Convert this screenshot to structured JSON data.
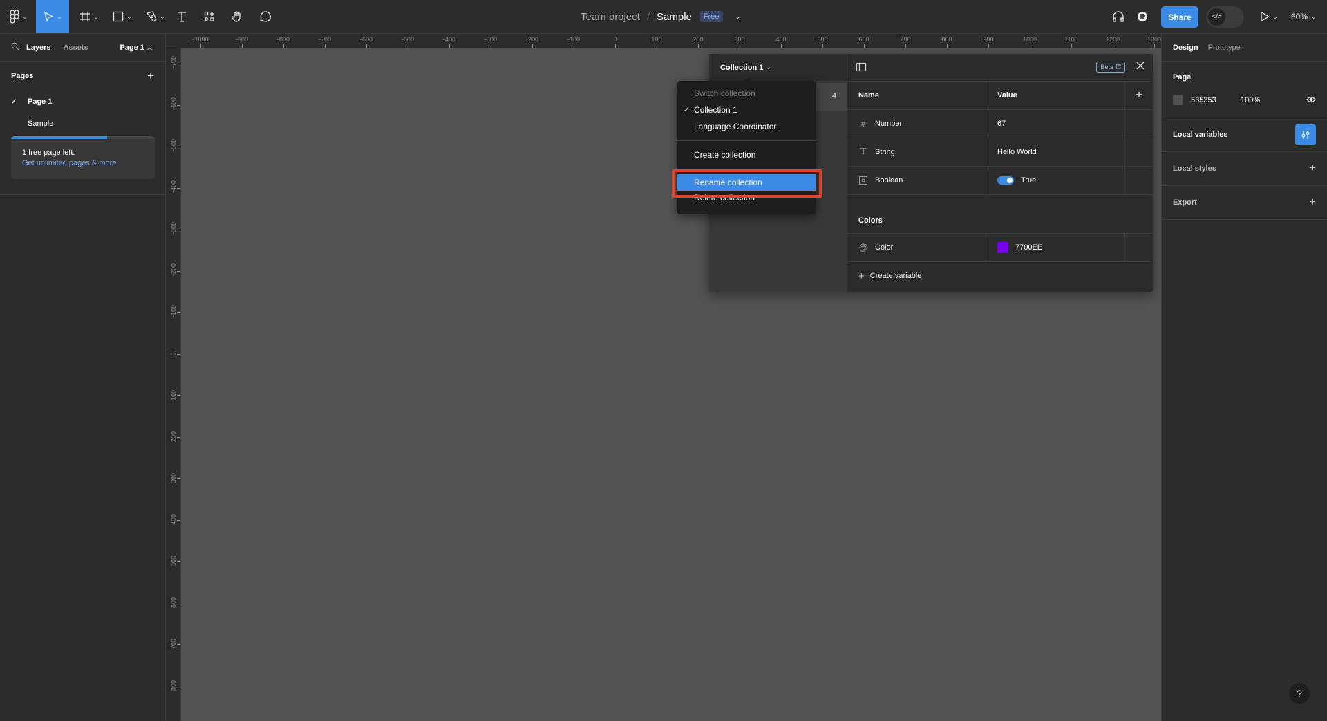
{
  "toolbar": {
    "tools": [
      {
        "name": "main-menu",
        "icon": "figma-logo-icon",
        "has_dropdown": true
      },
      {
        "name": "move-tool",
        "icon": "cursor-icon",
        "has_dropdown": true,
        "active": true
      },
      {
        "name": "frame-tool",
        "icon": "frame-icon",
        "has_dropdown": true
      },
      {
        "name": "shape-tool",
        "icon": "rectangle-icon",
        "has_dropdown": true
      },
      {
        "name": "pen-tool",
        "icon": "pen-icon",
        "has_dropdown": true
      },
      {
        "name": "text-tool",
        "icon": "text-icon",
        "has_dropdown": false
      },
      {
        "name": "resources-tool",
        "icon": "resources-icon",
        "has_dropdown": false
      },
      {
        "name": "hand-tool",
        "icon": "hand-icon",
        "has_dropdown": false
      },
      {
        "name": "comment-tool",
        "icon": "comment-icon",
        "has_dropdown": false
      }
    ],
    "breadcrumb": {
      "project": "Team project",
      "separator": "/",
      "file": "Sample",
      "plan_badge": "Free"
    },
    "share_label": "Share",
    "dev_mode_icon": "</>",
    "zoom_level": "60%",
    "accent_color": "#3b8ae6"
  },
  "left_panel": {
    "tabs": [
      {
        "label": "Layers",
        "active": true
      },
      {
        "label": "Assets",
        "active": false
      }
    ],
    "current_page": "Page 1",
    "pages_title": "Pages",
    "pages": [
      {
        "label": "Page 1",
        "active": true
      },
      {
        "label": "Sample",
        "active": false
      }
    ],
    "upsell": {
      "usage_fraction": 0.67,
      "text": "1 free page left.",
      "link": "Get unlimited pages & more"
    }
  },
  "rulers": {
    "horizontal": [
      "-1000",
      "-900",
      "-800",
      "-700",
      "-600",
      "-500",
      "-400",
      "-300",
      "-200",
      "-100",
      "0",
      "100",
      "200",
      "300",
      "400",
      "500",
      "600",
      "700",
      "800",
      "900",
      "1000",
      "1100",
      "1200",
      "1300"
    ],
    "vertical": [
      "-700",
      "-600",
      "-500",
      "-400",
      "-300",
      "-200",
      "-100",
      "0",
      "100",
      "200",
      "300",
      "400",
      "500",
      "600",
      "700",
      "800"
    ]
  },
  "canvas": {
    "background": "#535353"
  },
  "variables_panel": {
    "collection_name": "Collection 1",
    "variable_count": "4",
    "beta_label": "Beta",
    "columns": {
      "name": "Name",
      "value": "Value"
    },
    "variables": [
      {
        "type_icon": "number-icon",
        "glyph": "#",
        "name": "Number",
        "value": "67"
      },
      {
        "type_icon": "string-icon",
        "glyph": "T",
        "name": "String",
        "value": "Hello World"
      },
      {
        "type_icon": "boolean-icon",
        "glyph": "◻",
        "name": "Boolean",
        "value": "True",
        "toggle_on": true
      }
    ],
    "groups": [
      {
        "title": "Colors",
        "variables": [
          {
            "type_icon": "color-icon",
            "name": "Color",
            "value": "7700EE",
            "swatch": "#7700ee"
          }
        ]
      }
    ],
    "create_label": "Create variable"
  },
  "collection_menu": {
    "section_label": "Switch collection",
    "collections": [
      {
        "label": "Collection 1",
        "checked": true
      },
      {
        "label": "Language Coordinator",
        "checked": false
      }
    ],
    "actions": [
      {
        "label": "Create collection",
        "highlighted": false
      },
      {
        "label": "Rename collection",
        "highlighted": true
      },
      {
        "label": "Delete collection",
        "highlighted": false
      }
    ],
    "annotation_color": "#e2432a"
  },
  "right_panel": {
    "tabs": [
      {
        "label": "Design",
        "active": true
      },
      {
        "label": "Prototype",
        "active": false
      }
    ],
    "page_section": {
      "title": "Page",
      "color_hex": "535353",
      "opacity": "100%"
    },
    "local_variables": "Local variables",
    "local_styles": "Local styles",
    "export": "Export"
  },
  "help_label": "?"
}
